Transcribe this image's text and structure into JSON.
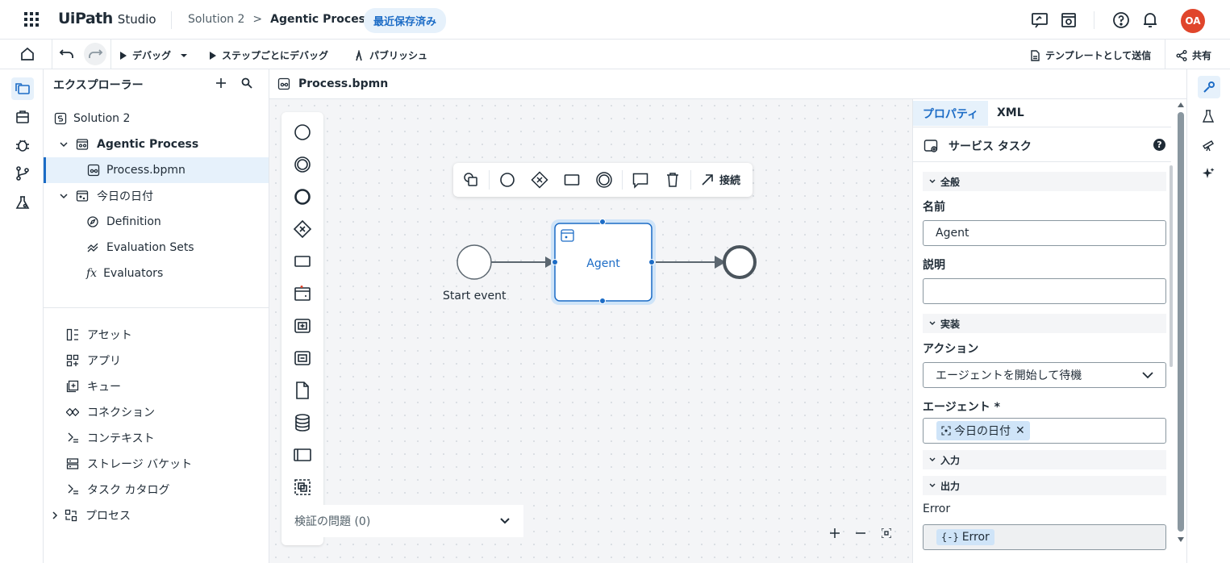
{
  "header": {
    "logo": "UiPath",
    "logo_sub": "Studio",
    "breadcrumb_solution": "Solution 2",
    "breadcrumb_sep": ">",
    "breadcrumb_process": "Agentic Process",
    "saved_badge": "最近保存済み",
    "avatar_initials": "OA"
  },
  "toolbar": {
    "debug": "デバッグ",
    "step_debug": "ステップごとにデバッグ",
    "publish": "パブリッシュ",
    "send_template": "テンプレートとして送信",
    "share": "共有"
  },
  "explorer": {
    "title": "エクスプローラー",
    "tree": {
      "solution": "Solution 2",
      "agentic_process": "Agentic Process",
      "process_bpmn": "Process.bpmn",
      "agent_today": "今日の日付",
      "definition": "Definition",
      "evaluation_sets": "Evaluation Sets",
      "evaluators": "Evaluators"
    },
    "resources": [
      "アセット",
      "アプリ",
      "キュー",
      "コネクション",
      "コンテキスト",
      "ストレージ バケット",
      "タスク カタログ",
      "プロセス"
    ]
  },
  "editor": {
    "tab": "Process.bpmn",
    "connect_label": "接続",
    "start_event_label": "Start event",
    "task_label": "Agent",
    "validation": "検証の問題 (0)"
  },
  "properties": {
    "tab_properties": "プロパティ",
    "tab_xml": "XML",
    "element_type": "サービス タスク",
    "section_general": "全般",
    "name_label": "名前",
    "name_value": "Agent",
    "description_label": "説明",
    "description_value": "",
    "section_impl": "実装",
    "action_label": "アクション",
    "action_value": "エージェントを開始して待機",
    "agent_label": "エージェント *",
    "agent_chip": "今日の日付",
    "section_input": "入力",
    "section_output": "出力",
    "error_label": "Error",
    "error_chip": "Error"
  },
  "colors": {
    "accent": "#1c6cc6",
    "selection": "#e6f1fb",
    "avatar": "#e0452b"
  }
}
